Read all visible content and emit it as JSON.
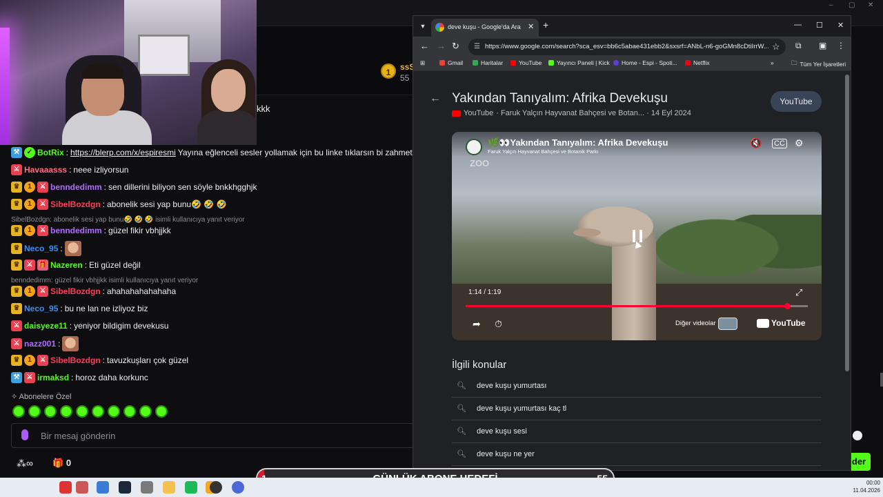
{
  "background_app": {
    "header": {
      "name": "ssS",
      "count": "55",
      "sub_tier": "1"
    },
    "prev_message": "kkk",
    "messages": [
      {
        "user": "BotRix",
        "color": "#53fc18",
        "badges": [
          "bot",
          "verified"
        ],
        "link": "https://blerp.com/x/espiresmi",
        "text": "Yayına eğlenceli sesler yollamak için bu linke tıklarsın bi zahmet!!!"
      },
      {
        "user": "Havaaasss",
        "color": "#ff6b81",
        "badges": [
          "mod"
        ],
        "text": "neee izliyorsun"
      },
      {
        "user": "benndedimm",
        "color": "#b26bff",
        "badges": [
          "crown",
          "sub",
          "mod"
        ],
        "text": "sen dillerini biliyon sen söyle bnkkhgghjk"
      },
      {
        "user": "SibelBozdgn",
        "color": "#ff3b5c",
        "badges": [
          "crown",
          "sub",
          "mod"
        ],
        "text": "abonelik sesi yap bunu🤣 🤣 🤣"
      },
      {
        "user": "benndedimm",
        "color": "#b26bff",
        "badges": [
          "crown",
          "sub",
          "mod"
        ],
        "text": "güzel fikir vbhjjkk"
      },
      {
        "user": "Neco_95",
        "color": "#3b8eea",
        "badges": [
          "crown"
        ],
        "text": ""
      },
      {
        "user": "Nazeren",
        "color": "#53fc18",
        "badges": [
          "crown",
          "mod",
          "gift"
        ],
        "text": "Eti güzel değil"
      },
      {
        "user": "SibelBozdgn",
        "color": "#ff3b5c",
        "badges": [
          "crown",
          "sub",
          "mod"
        ],
        "text": "ahahahahahahaha"
      },
      {
        "user": "Neco_95",
        "color": "#3b8eea",
        "badges": [
          "crown"
        ],
        "text": "bu ne lan ne izliyoz biz"
      },
      {
        "user": "daisyeze11",
        "color": "#53fc18",
        "badges": [
          "mod"
        ],
        "text": "yeniyor bildigim devekusu"
      },
      {
        "user": "nazz001",
        "color": "#b26bff",
        "badges": [
          "mod"
        ],
        "text": ""
      },
      {
        "user": "SibelBozdgn",
        "color": "#ff3b5c",
        "badges": [
          "crown",
          "sub",
          "mod"
        ],
        "text": "tavuzkuşları çok güzel"
      },
      {
        "user": "irmaksd",
        "color": "#53fc18",
        "badges": [
          "bot",
          "mod"
        ],
        "text": "horoz daha korkunc"
      }
    ],
    "replies": [
      "SibelBozdgn: abonelik sesi yap bunu🤣 🤣 🤣 isimli kullanıcıya yanıt veriyor",
      "benndedimm: güzel fikir vbhjjkk isimli kullanıcıya yanıt veriyor"
    ],
    "subscriber_label": "Abonelere Özel",
    "chat_placeholder": "Bir mesaj gönderin",
    "footer_count": "0",
    "send_label": "der"
  },
  "chrome": {
    "tab_title": "deve kuşu - Google'da Ara",
    "url": "https://www.google.com/search?sca_esv=bb6c5abae431ebb2&sxsrf=ANbL-n6-goGMn8cDtiIrrW...",
    "bookmarks": [
      {
        "label": "Gmail",
        "color": "#ea4335"
      },
      {
        "label": "Haritalar",
        "color": "#34a853"
      },
      {
        "label": "YouTube",
        "color": "#ff0000"
      },
      {
        "label": "Yayıncı Paneli | Kick",
        "color": "#53fc18"
      },
      {
        "label": "Home - Espi - Spoti...",
        "color": "#5b3fd6"
      },
      {
        "label": "Netflix",
        "color": "#e50914"
      }
    ],
    "all_bookmarks": "Tüm Yer İşaretleri",
    "result": {
      "title": "Yakından Tanıyalım: Afrika Devekuşu",
      "source": "YouTube",
      "channel_date": "· Faruk Yalçın Hayvanat Bahçesi ve Botan... · 14 Eyl 2024",
      "pill": "YouTube"
    },
    "player": {
      "title": "🌿👀Yakından Tanıyalım: Afrika Devekuşu",
      "channel": "Faruk Yalçın Hayvanat Bahçesi ve Botanik Parkı",
      "watermark": "ZOO",
      "time": "1:14 / 1:19",
      "progress": 0.94,
      "more_videos": "Diğer videolar",
      "logo": "YouTube"
    },
    "related_heading": "İlgili konular",
    "related": [
      "deve kuşu yumurtası",
      "deve kuşu yumurtası kaç tl",
      "deve kuşu sesi",
      "deve kuşu ne yer"
    ]
  },
  "goal": {
    "label": "GÜNLÜK ABONE HEDEFİ",
    "start": "1",
    "end": "55",
    "progress": 0.02
  },
  "taskbar": {
    "time": "00:00",
    "date": "11.04.2026"
  }
}
